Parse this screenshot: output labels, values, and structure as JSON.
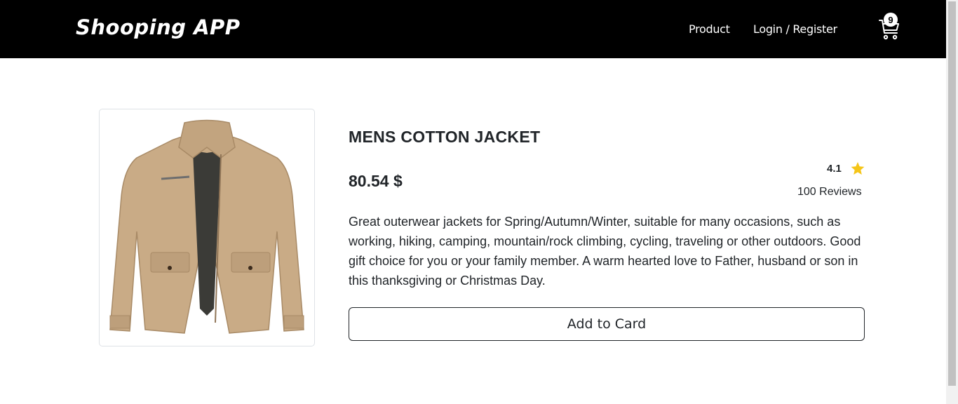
{
  "navbar": {
    "brand": "Shooping APP",
    "links": [
      "Product",
      "Login / Register"
    ],
    "cart": {
      "icon": "cart-icon",
      "count": "9"
    }
  },
  "product": {
    "image_alt": "Mens cotton jacket",
    "title": "MENS COTTON JACKET",
    "price": "80.54 $",
    "rating": "4.1",
    "rating_icon": "star-icon",
    "reviews": "100 Reviews",
    "description": "Great outerwear jackets for Spring/Autumn/Winter, suitable for many occasions, such as working, hiking, camping, mountain/rock climbing, cycling, traveling or other outdoors. Good gift choice for you or your family member. A warm hearted love to Father, husband or son in this thanksgiving or Christmas Day.",
    "button_label": "Add to Card"
  },
  "colors": {
    "navbar_bg": "#000000",
    "star": "#f5c518",
    "jacket": "#c9ab86"
  }
}
